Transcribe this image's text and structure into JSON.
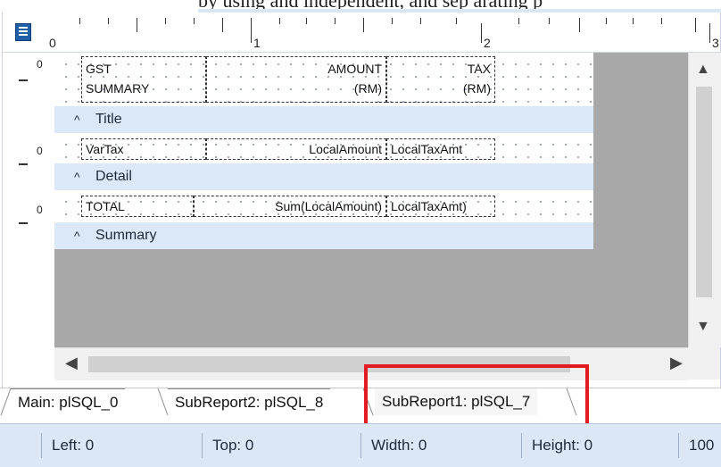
{
  "top_caption": "by using and independent, and sep arating p",
  "ruler": {
    "labels": [
      "0",
      "1",
      "2",
      "3"
    ]
  },
  "bands": [
    {
      "name": "Title",
      "caret": "^",
      "row_number": "0",
      "fields": [
        {
          "lines": [
            "GST",
            "SUMMARY"
          ],
          "align": "left"
        },
        {
          "lines": [
            "AMOUNT",
            "(RM)"
          ],
          "align": "right"
        },
        {
          "lines": [
            "TAX",
            "(RM)"
          ],
          "align": "right"
        }
      ]
    },
    {
      "name": "Detail",
      "caret": "^",
      "row_number": "0",
      "fields": [
        {
          "lines": [
            "VarTax"
          ],
          "align": "left"
        },
        {
          "lines": [
            "LocalAmount"
          ],
          "align": "right"
        },
        {
          "lines": [
            "LocalTaxAmt"
          ],
          "align": "left"
        }
      ]
    },
    {
      "name": "Summary",
      "caret": "^",
      "row_number": "0",
      "fields": [
        {
          "lines": [
            "TOTAL"
          ],
          "align": "left"
        },
        {
          "lines": [
            "Sum(LocalAmount)"
          ],
          "align": "right"
        },
        {
          "lines": [
            "LocalTaxAmt)"
          ],
          "align": "left"
        }
      ]
    }
  ],
  "tabs": [
    {
      "label": "Main: plSQL_0",
      "active": false
    },
    {
      "label": "SubReport2: plSQL_8",
      "active": false
    },
    {
      "label": "SubReport1: plSQL_7",
      "active": true
    }
  ],
  "status": {
    "left": "Left: 0",
    "top": "Top: 0",
    "width": "Width: 0",
    "height": "Height: 0",
    "zoom": "100"
  },
  "scroll_icons": {
    "up": "▲",
    "down": "▼",
    "left": "◀",
    "right": "▶"
  },
  "colors": {
    "highlight": "#e21b23",
    "band_header": "#dbe8f7",
    "workspace_gray": "#a8a8a8",
    "status_bar": "#dbe7f5"
  }
}
